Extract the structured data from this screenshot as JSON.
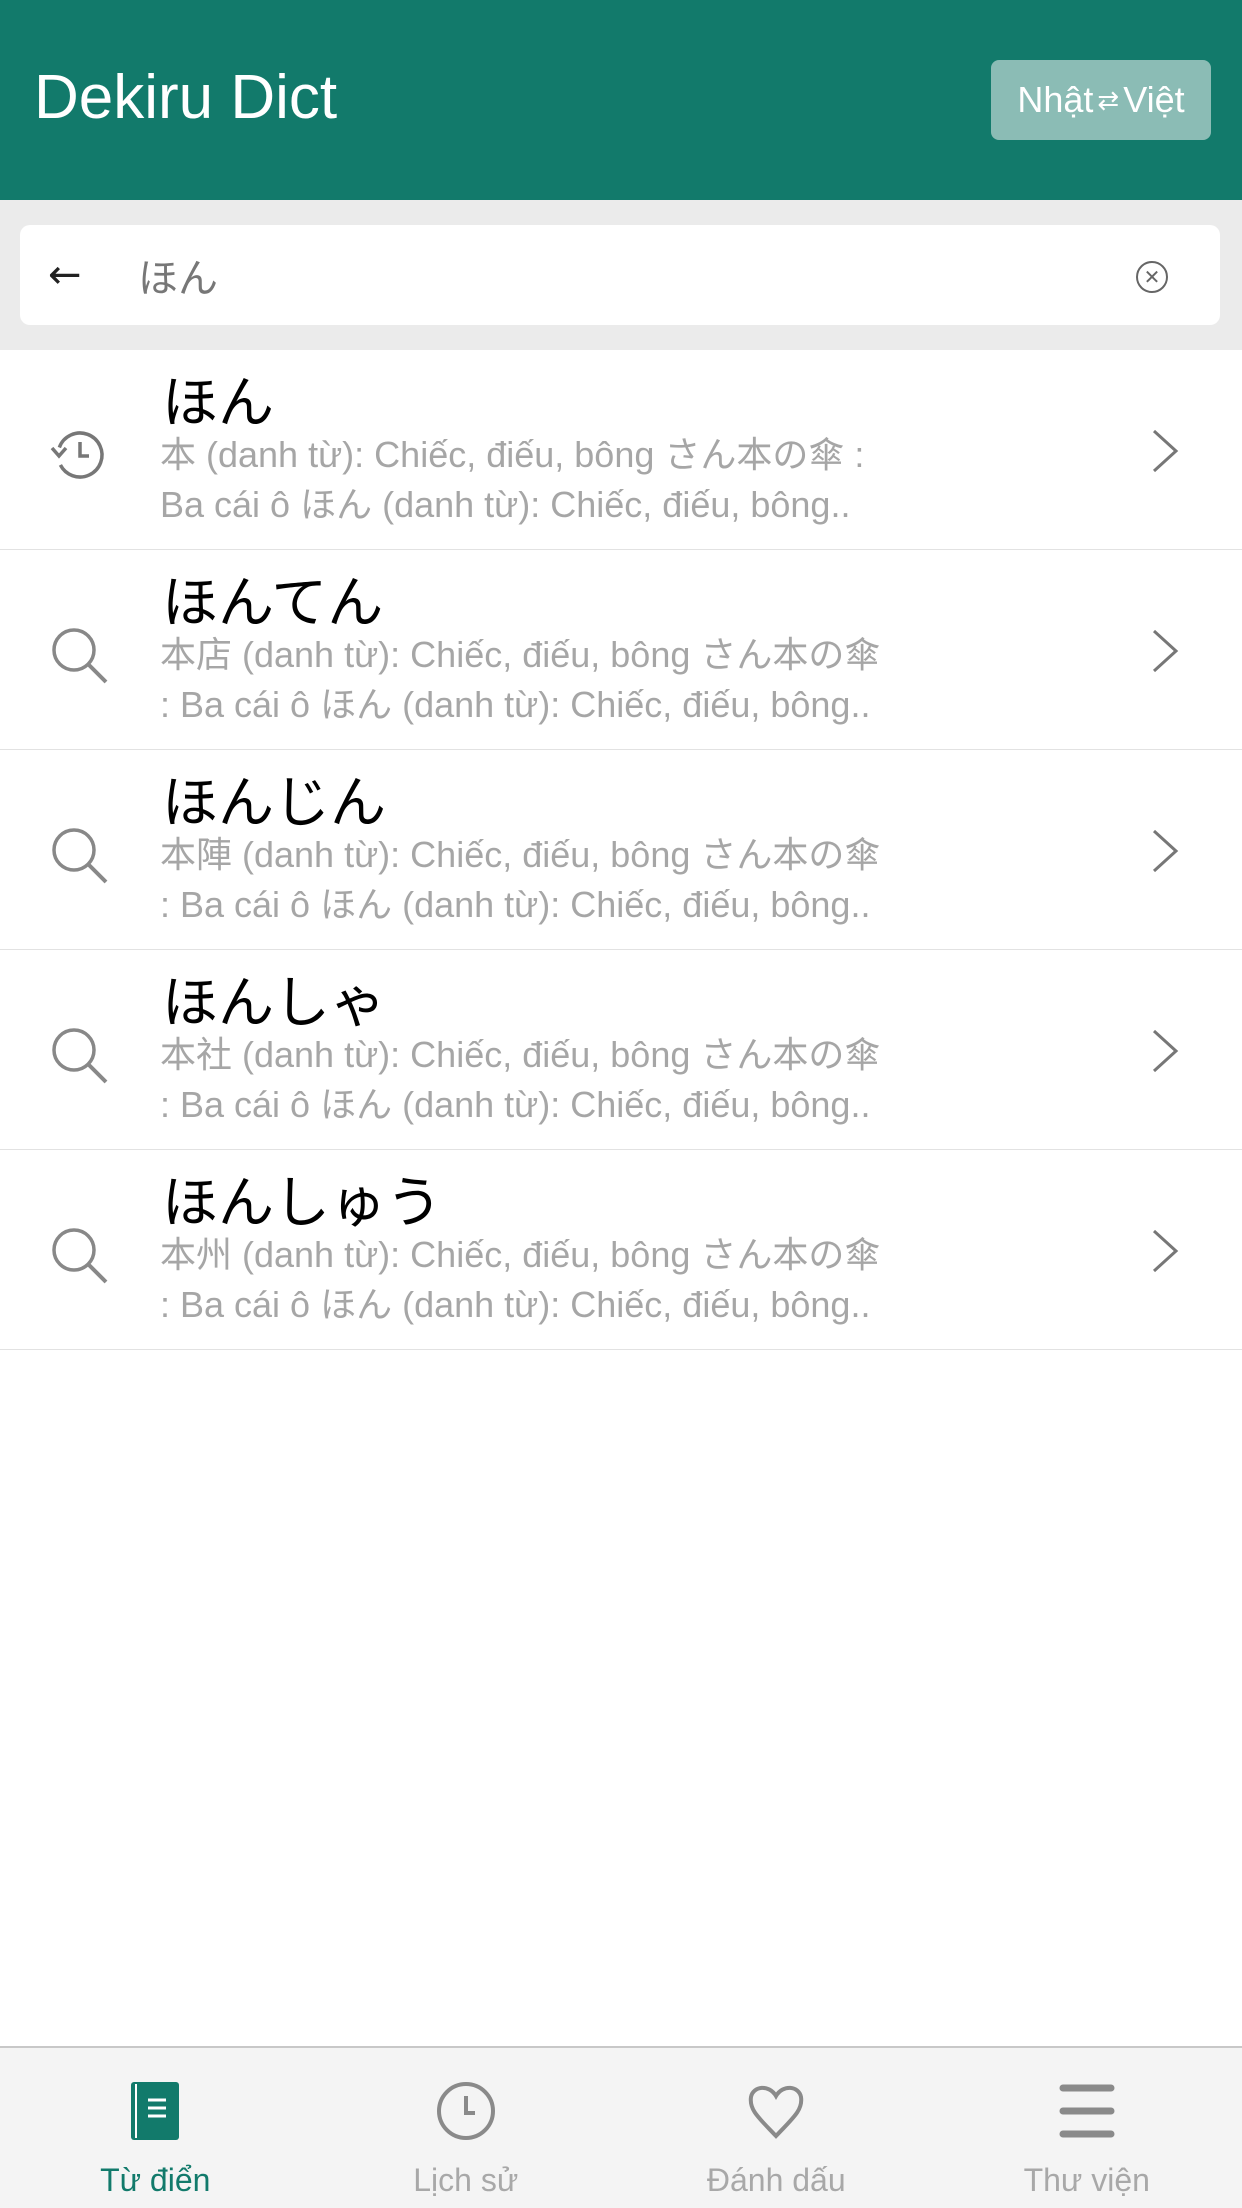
{
  "header": {
    "title": "Dekiru Dict",
    "lang_from": "Nhật",
    "lang_swap_icon": "swap-arrows-icon",
    "lang_to": "Việt"
  },
  "search": {
    "value": "ほん",
    "back_icon": "arrow-left-icon",
    "clear_icon": "clear-circle-icon"
  },
  "results": [
    {
      "icon": "history-icon",
      "word": "ほん",
      "gloss": "本 (danh từ): Chiếc, điếu, bông さん本の傘 :\nBa cái ô ほん (danh từ): Chiếc, điếu, bông.."
    },
    {
      "icon": "search-icon",
      "word": "ほんてん",
      "gloss": "本店 (danh từ): Chiếc, điếu, bông さん本の傘\n: Ba cái ô ほん (danh từ): Chiếc, điếu, bông.."
    },
    {
      "icon": "search-icon",
      "word": "ほんじん",
      "gloss": "本陣 (danh từ): Chiếc, điếu, bông さん本の傘\n: Ba cái ô ほん (danh từ): Chiếc, điếu, bông.."
    },
    {
      "icon": "search-icon",
      "word": "ほんしゃ",
      "gloss": "本社 (danh từ): Chiếc, điếu, bông さん本の傘\n: Ba cái ô ほん (danh từ): Chiếc, điếu, bông.."
    },
    {
      "icon": "search-icon",
      "word": "ほんしゅう",
      "gloss": "本州 (danh từ): Chiếc, điếu, bông さん本の傘\n: Ba cái ô ほん (danh từ): Chiếc, điếu, bông.."
    }
  ],
  "tabs": [
    {
      "label": "Từ điển",
      "icon": "book-icon",
      "active": true
    },
    {
      "label": "Lịch sử",
      "icon": "clock-icon"
    },
    {
      "label": "Đánh dấu",
      "icon": "heart-icon"
    },
    {
      "label": "Thư viện",
      "icon": "menu-icon"
    }
  ],
  "colors": {
    "primary": "#127a6b",
    "lang_button": "#8bbcb5",
    "gloss": "#a6a6a6",
    "tab_inactive": "#a8a8a8"
  }
}
